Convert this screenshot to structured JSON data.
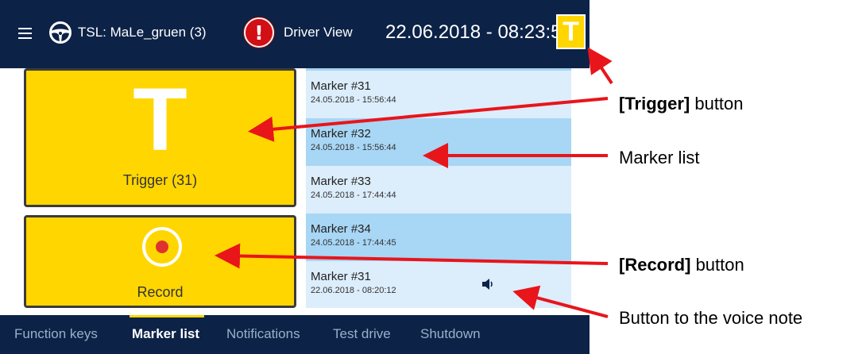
{
  "header": {
    "track_label": "TSL: MaLe_gruen (3)",
    "view_label": "Driver View",
    "datetime": "22.06.2018 - 08:23:53",
    "trigger_badge": "T"
  },
  "trigger_button": {
    "glyph": "T",
    "label": "Trigger (31)"
  },
  "record_button": {
    "label": "Record"
  },
  "markers": [
    {
      "name": "Marker #31",
      "date": "24.05.2018 - 15:56:44"
    },
    {
      "name": "Marker #32",
      "date": "24.05.2018 - 15:56:44"
    },
    {
      "name": "Marker #33",
      "date": "24.05.2018 - 17:44:44"
    },
    {
      "name": "Marker #34",
      "date": "24.05.2018 - 17:44:45"
    },
    {
      "name": "Marker #31",
      "date": "22.06.2018 - 08:20:12",
      "icon": "speaker-icon"
    }
  ],
  "nav": {
    "tabs": [
      "Function keys",
      "Marker list",
      "Notifications",
      "Test drive",
      "Shutdown"
    ],
    "active": "Marker list"
  },
  "annotations": {
    "trigger_bold": "[Trigger]",
    "trigger_rest": " button",
    "marker_list": "Marker list",
    "record_bold": "[Record]",
    "record_rest": " button",
    "voice_note": "Button to the voice note"
  },
  "colors": {
    "navy": "#0c2247",
    "yellow": "#ffd600",
    "list_bg": "#dcedfb",
    "list_alt": "#a8d6f5",
    "arrow": "#e8151b"
  }
}
